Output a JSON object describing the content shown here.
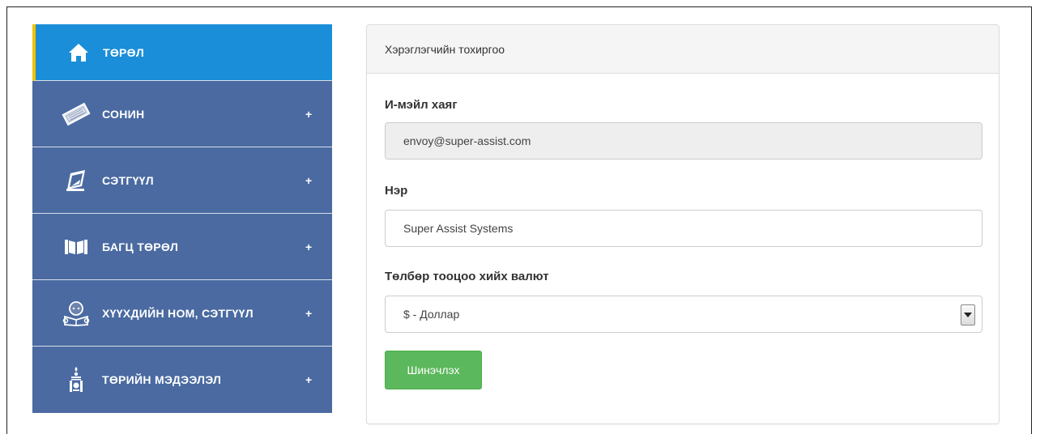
{
  "sidebar": {
    "items": [
      {
        "label": "ТӨРӨЛ",
        "icon": "home-icon",
        "active": true,
        "has_plus": false
      },
      {
        "label": "СОНИН",
        "icon": "newspaper-icon",
        "active": false,
        "has_plus": true,
        "plus": "+"
      },
      {
        "label": "СЭТГҮҮЛ",
        "icon": "magazine-icon",
        "active": false,
        "has_plus": true,
        "plus": "+"
      },
      {
        "label": "БАГЦ ТӨРӨЛ",
        "icon": "book-icon",
        "active": false,
        "has_plus": true,
        "plus": "+"
      },
      {
        "label": "ХҮҮХДИЙН НОМ, СЭТГҮҮЛ",
        "icon": "child-reading-icon",
        "active": false,
        "has_plus": true,
        "plus": "+"
      },
      {
        "label": "ТӨРИЙН МЭДЭЭЛЭЛ",
        "icon": "soyombo-icon",
        "active": false,
        "has_plus": true,
        "plus": "+"
      }
    ],
    "colors": {
      "background": "#4a6aa1",
      "active": "#1a8ed9",
      "active_border": "#f2c200"
    }
  },
  "panel": {
    "title": "Хэрэглэгчийн тохиргоо",
    "email": {
      "label": "И-мэйл хаяг",
      "value": "envoy@super-assist.com"
    },
    "name": {
      "label": "Нэр",
      "value": "Super Assist Systems"
    },
    "currency": {
      "label": "Төлбөр тооцоо хийх валют",
      "selected": "$ - Доллар"
    },
    "update_button": "Шинэчлэх",
    "colors": {
      "button": "#5cb85c"
    }
  }
}
